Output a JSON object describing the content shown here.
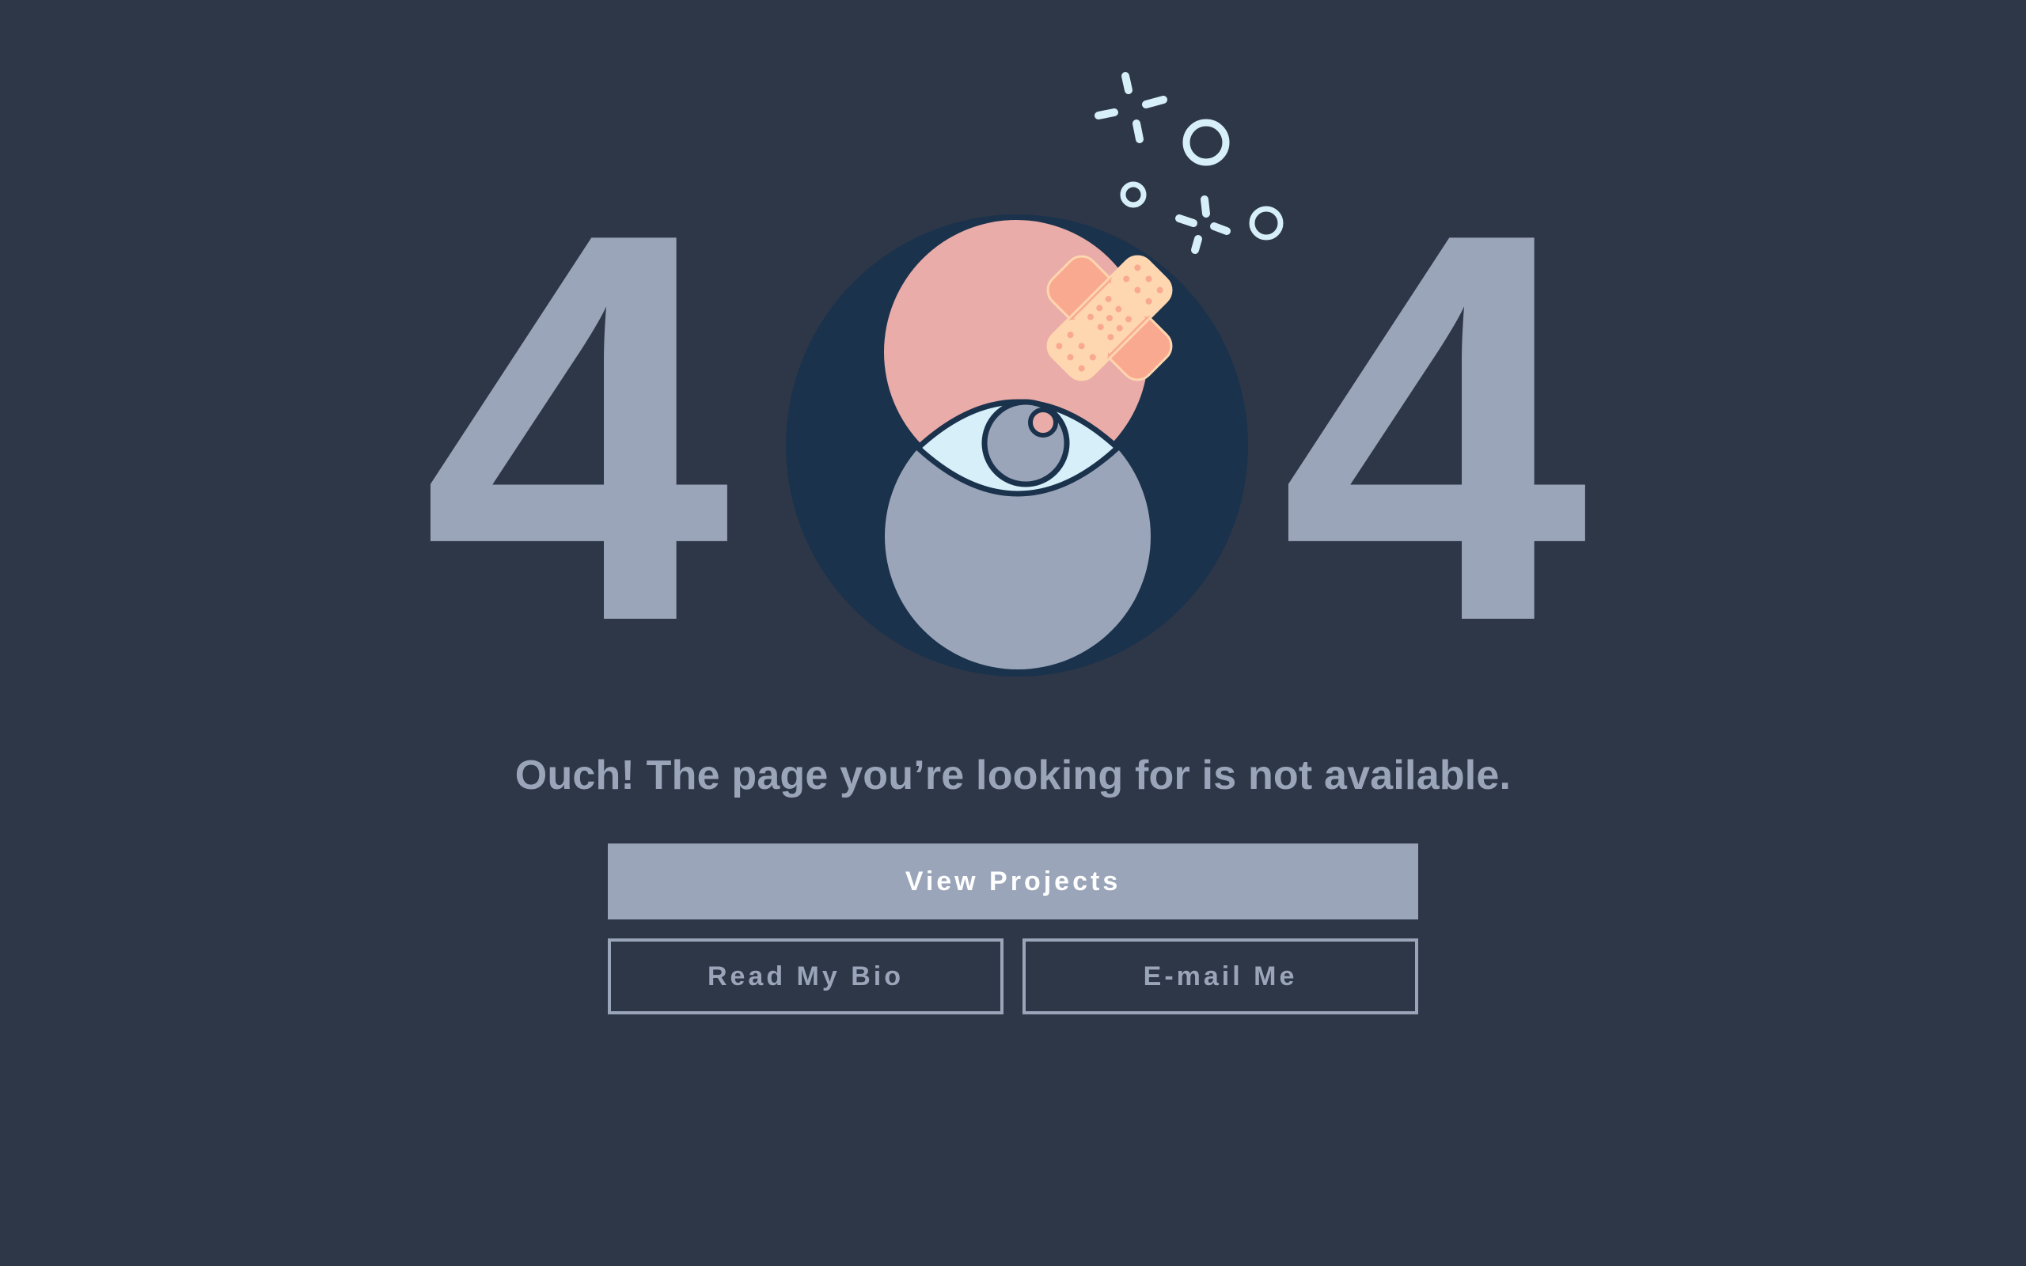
{
  "error": {
    "digit_left": "4",
    "digit_right": "4"
  },
  "message": "Ouch! The page you’re looking for is not available.",
  "buttons": {
    "primary_label": "View Projects",
    "bio_label": "Read My Bio",
    "email_label": "E-mail Me"
  },
  "colors": {
    "background": "#2d3748",
    "muted": "#9aa5b9",
    "circle": "#1a324c",
    "pink": "#eaaca8",
    "eye": "#d6eff8",
    "bandage": "#f9a98f",
    "bandage_pad": "#fed6b0",
    "sparkle": "#d6eff8"
  },
  "icons": {
    "illustration": "bandaged-eye-zero-icon",
    "sparkles": "sparkle-icon"
  }
}
